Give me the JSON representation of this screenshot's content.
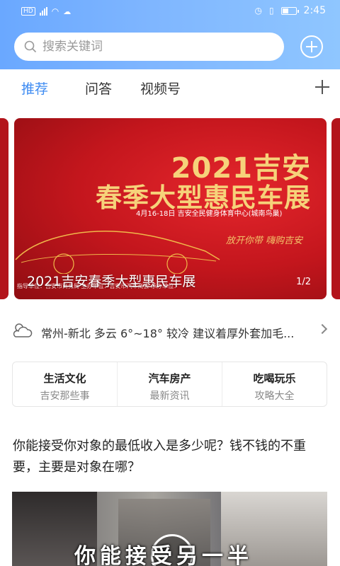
{
  "status_bar": {
    "network": "HD",
    "time": "2:45"
  },
  "search": {
    "placeholder": "搜索关键词"
  },
  "tabs": [
    {
      "label": "推荐",
      "active": true
    },
    {
      "label": "问答",
      "active": false
    },
    {
      "label": "视频号",
      "active": false
    }
  ],
  "banner": {
    "headline_1": "2021吉安",
    "headline_2": "春季大型惠民车展",
    "details": "4月16-18日  吉安全民健身体育中心(城南鸟巢)",
    "slogan": "放开你带 嗨购吉安",
    "caption": "2021吉安春季大型惠民车展",
    "sponsors": "指导单位：吉安市商务局  主办单位：吉安市汽车商会  承办单位：",
    "counter": "1/2"
  },
  "weather": {
    "text": "常州-新北 多云 6°~18° 较冷 建议着厚外套加毛..."
  },
  "categories": [
    {
      "title": "生活文化",
      "subtitle": "吉安那些事"
    },
    {
      "title": "汽车房产",
      "subtitle": "最新资讯"
    },
    {
      "title": "吃喝玩乐",
      "subtitle": "攻略大全"
    }
  ],
  "article": {
    "title": "你能接受你对象的最低收入是多少呢？钱不钱的不重要，主要是对象在哪？",
    "video_subtitle": "你能接受另一半"
  },
  "colors": {
    "header_blue": "#7fb6ff",
    "accent_blue": "#3d8bf2",
    "banner_red": "#c4161d",
    "banner_gold": "#f6d27a"
  },
  "icons": [
    "search-icon",
    "add-circle-icon",
    "add-tab-icon",
    "cloud-sun-icon",
    "chevron-right-icon",
    "play-icon"
  ]
}
